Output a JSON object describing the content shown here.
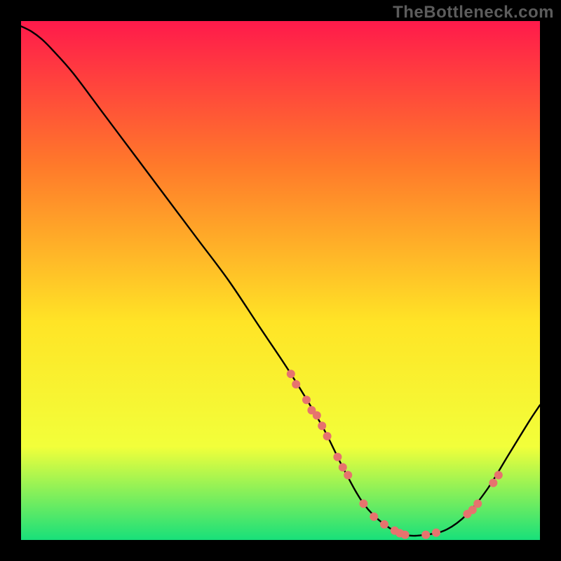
{
  "watermark": "TheBottleneck.com",
  "colors": {
    "background": "#000000",
    "gradient_top": "#ff1a4b",
    "gradient_mid1": "#ff7a2a",
    "gradient_mid2": "#ffe426",
    "gradient_mid3": "#f2ff3a",
    "gradient_bottom": "#18e07a",
    "curve": "#000000",
    "marker": "#e6736e",
    "watermark": "#5c5c5c"
  },
  "chart_data": {
    "type": "line",
    "title": "",
    "xlabel": "",
    "ylabel": "",
    "xlim": [
      0,
      100
    ],
    "ylim": [
      0,
      100
    ],
    "grid": false,
    "legend": false,
    "annotations": [],
    "series": [
      {
        "name": "bottleneck-curve",
        "x": [
          0,
          2,
          4,
          6,
          10,
          16,
          22,
          28,
          34,
          40,
          46,
          52,
          58,
          62,
          66,
          70,
          74,
          78,
          82,
          86,
          90,
          94,
          98,
          100
        ],
        "y": [
          99,
          98,
          96.5,
          94.5,
          90,
          82,
          74,
          66,
          58,
          50,
          41,
          32,
          22,
          14,
          7,
          3,
          1,
          1,
          2,
          5,
          10,
          16.5,
          23,
          26
        ]
      }
    ],
    "markers": {
      "name": "highlighted-points",
      "x": [
        52,
        53,
        55,
        56,
        57,
        58,
        59,
        61,
        62,
        63,
        66,
        68,
        70,
        72,
        73,
        74,
        78,
        80,
        86,
        87,
        88,
        91,
        92
      ],
      "y": [
        32,
        30,
        27,
        25,
        24,
        22,
        20,
        16,
        14,
        12.5,
        7,
        4.5,
        3,
        1.8,
        1.3,
        1,
        1,
        1.4,
        5,
        5.8,
        7,
        11,
        12.5
      ]
    }
  }
}
